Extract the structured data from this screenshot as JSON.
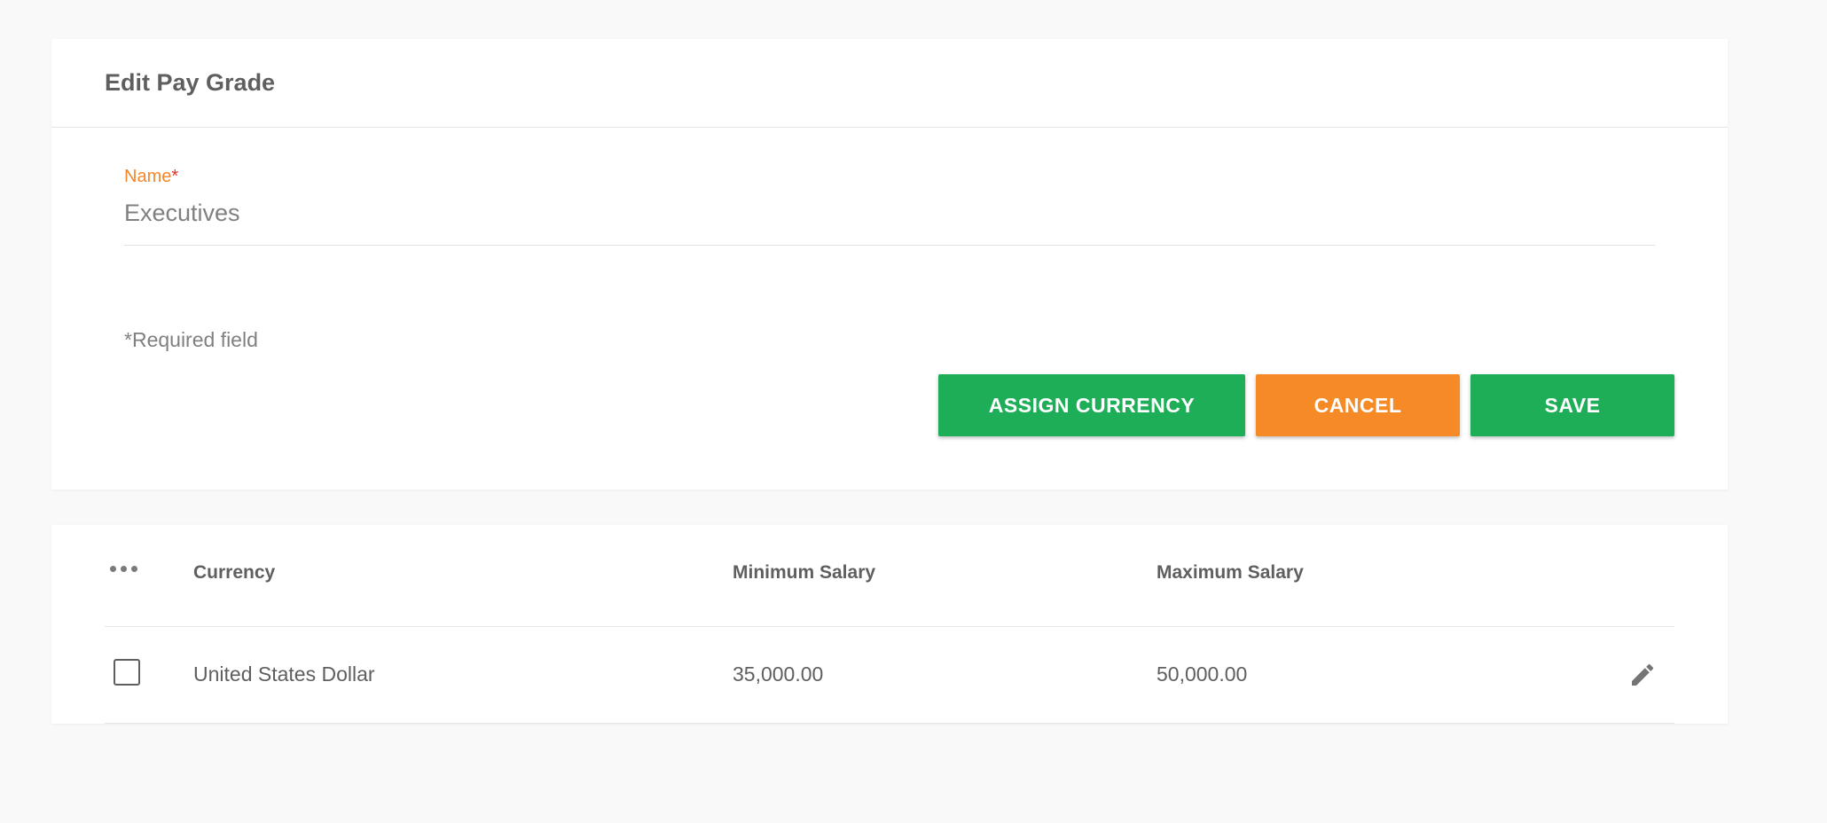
{
  "edit_card": {
    "title": "Edit Pay Grade",
    "name_field": {
      "label": "Name",
      "required_marker": "*",
      "value": "Executives"
    },
    "required_note": {
      "marker": "*",
      "text": "Required field"
    },
    "buttons": {
      "assign_currency": "ASSIGN CURRENCY",
      "cancel": "CANCEL",
      "save": "SAVE"
    }
  },
  "currency_table": {
    "columns": {
      "currency": "Currency",
      "minimum_salary": "Minimum Salary",
      "maximum_salary": "Maximum Salary"
    },
    "rows": [
      {
        "currency": "United States Dollar",
        "minimum_salary": "35,000.00",
        "maximum_salary": "50,000.00",
        "selected": false
      }
    ]
  },
  "icons": {
    "header_menu": "more-horizontal-icon",
    "row_edit": "pencil-icon"
  },
  "colors": {
    "primary_green": "#1fae58",
    "accent_orange": "#f58a27",
    "required_red": "#e0302a",
    "background": "#f9f9f9"
  }
}
